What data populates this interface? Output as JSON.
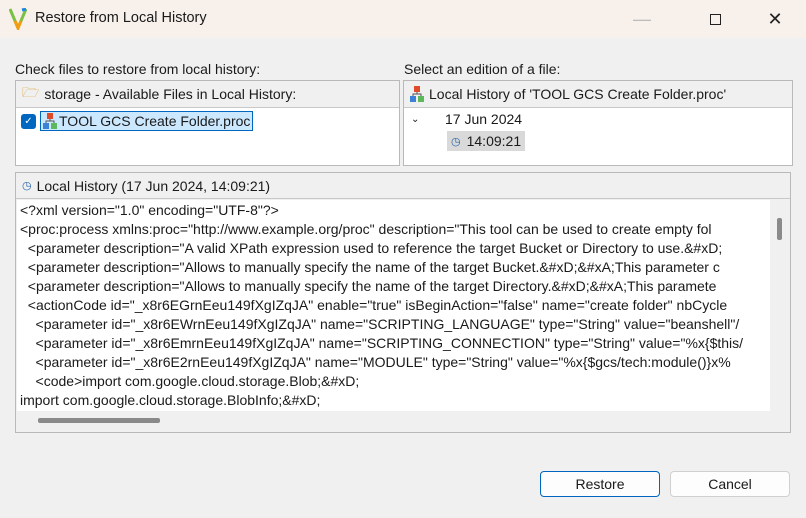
{
  "window": {
    "title": "Restore from Local History"
  },
  "left": {
    "label": "Check files to restore from local history:",
    "header": "storage - Available Files in Local History:",
    "files": [
      {
        "name": "TOOL GCS Create Folder.proc",
        "checked": true
      }
    ]
  },
  "right": {
    "label": "Select an edition of a file:",
    "header": "Local History of 'TOOL GCS Create Folder.proc'",
    "date": "17 Jun 2024",
    "time": "14:09:21"
  },
  "preview": {
    "header": "Local History (17 Jun 2024, 14:09:21)",
    "lines": [
      "<?xml version=\"1.0\" encoding=\"UTF-8\"?>",
      "<proc:process xmlns:proc=\"http://www.example.org/proc\" description=\"This tool can be used to create empty fol",
      "  <parameter description=\"A valid XPath expression used to reference the target Bucket or Directory to use.&#xD;",
      "  <parameter description=\"Allows to manually specify the name of the target Bucket.&#xD;&#xA;This parameter c",
      "  <parameter description=\"Allows to manually specify the name of the target Directory.&#xD;&#xA;This paramete",
      "  <actionCode id=\"_x8r6EGrnEeu149fXgIZqJA\" enable=\"true\" isBeginAction=\"false\" name=\"create folder\" nbCycle",
      "    <parameter id=\"_x8r6EWrnEeu149fXgIZqJA\" name=\"SCRIPTING_LANGUAGE\" type=\"String\" value=\"beanshell\"/",
      "    <parameter id=\"_x8r6EmrnEeu149fXgIZqJA\" name=\"SCRIPTING_CONNECTION\" type=\"String\" value=\"%x{$this/",
      "    <parameter id=\"_x8r6E2rnEeu149fXgIZqJA\" name=\"MODULE\" type=\"String\" value=\"%x{$gcs/tech:module()}x%",
      "    <code>import com.google.cloud.storage.Blob;&#xD;",
      "import com.google.cloud.storage.BlobInfo;&#xD;"
    ]
  },
  "buttons": {
    "restore": "Restore",
    "cancel": "Cancel"
  },
  "colors": {
    "accent": "#0067c0",
    "selection": "#cce8ff"
  }
}
